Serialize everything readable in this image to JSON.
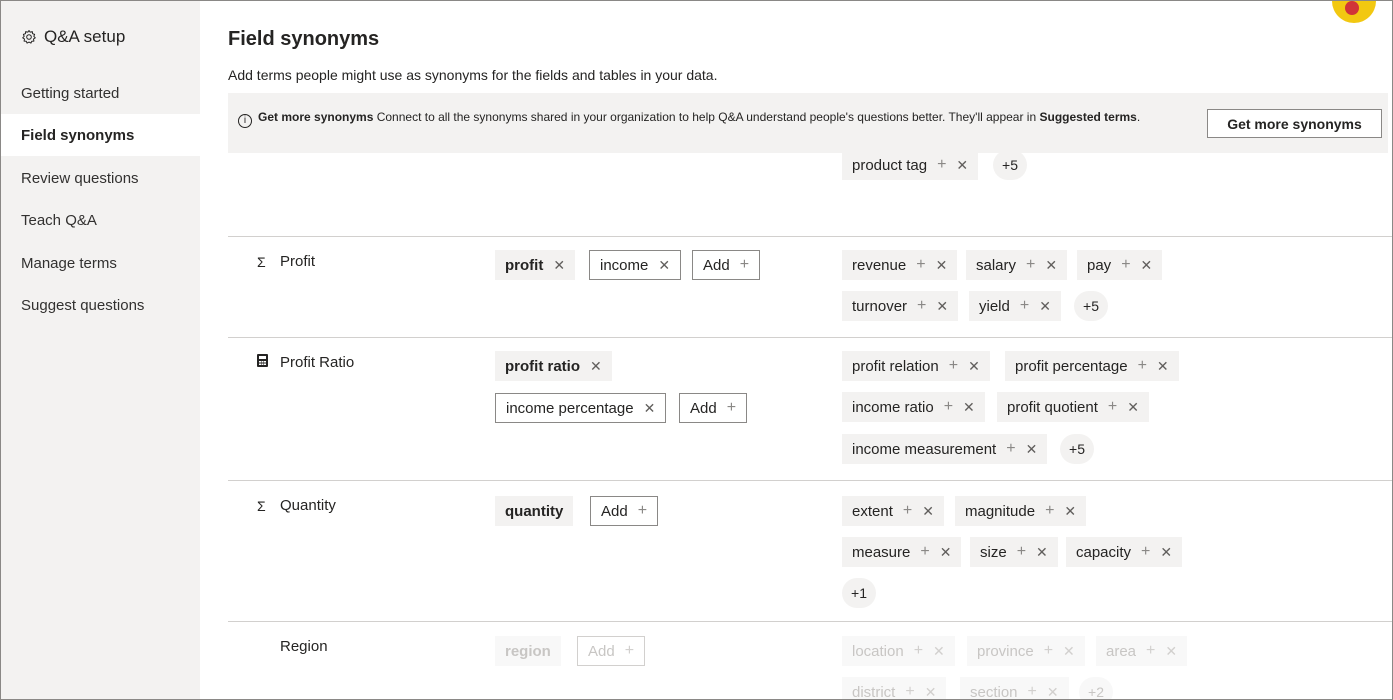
{
  "sidebar": {
    "header": "Q&A setup",
    "header_icon": "gear-icon",
    "items": [
      {
        "label": "Getting started"
      },
      {
        "label": "Field synonyms",
        "active": true
      },
      {
        "label": "Review questions"
      },
      {
        "label": "Teach Q&A"
      },
      {
        "label": "Manage terms"
      },
      {
        "label": "Suggest questions"
      }
    ]
  },
  "main": {
    "title": "Field synonyms",
    "subtitle": "Add terms people might use as synonyms for the fields and tables in your data."
  },
  "banner": {
    "bold_lead": "Get more synonyms",
    "text": " Connect to all the synonyms shared in your organization to help Q&A understand people's questions better. They'll appear in ",
    "bold_tail": "Suggested terms",
    "period": ".",
    "button": "Get more synonyms"
  },
  "rows": {
    "partial": {
      "sugg": [
        "product tag"
      ],
      "more": "+5"
    },
    "profit": {
      "name": "Profit",
      "icon": "Σ",
      "primary": "profit",
      "terms": [
        "income"
      ],
      "add": "Add",
      "sugg": [
        "revenue",
        "salary",
        "pay",
        "turnover",
        "yield"
      ],
      "more": "+5",
      "enabled": true
    },
    "profit_ratio": {
      "name": "Profit Ratio",
      "icon": "calculator-icon",
      "primary": "profit ratio",
      "terms": [
        "income percentage"
      ],
      "add": "Add",
      "sugg": [
        "profit relation",
        "profit percentage",
        "income ratio",
        "profit quotient",
        "income measurement"
      ],
      "more": "+5",
      "enabled": true
    },
    "quantity": {
      "name": "Quantity",
      "icon": "Σ",
      "primary": "quantity",
      "add": "Add",
      "sugg": [
        "extent",
        "magnitude",
        "measure",
        "size",
        "capacity"
      ],
      "more": "+1",
      "enabled": true
    },
    "region": {
      "name": "Region",
      "primary": "region",
      "add": "Add",
      "sugg": [
        "location",
        "province",
        "area",
        "district",
        "section"
      ],
      "more": "+2",
      "enabled": false
    }
  },
  "colors": {
    "accent": "#f2c811",
    "toggle_off": "#605e5c",
    "sidebar_bg": "#f3f2f1",
    "chip_bg": "#f3f2f1"
  }
}
